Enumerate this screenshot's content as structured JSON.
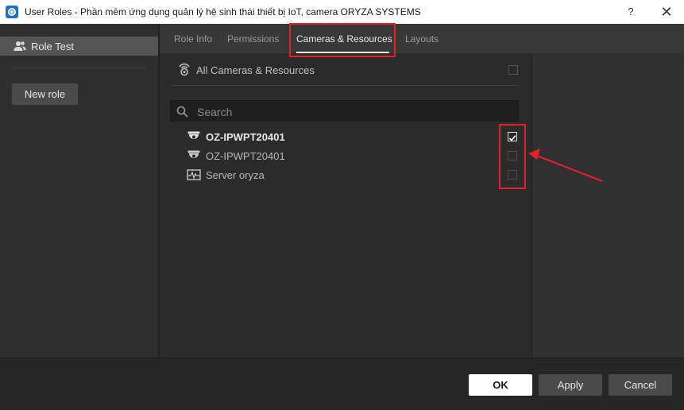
{
  "window": {
    "title": "User Roles - Phần mềm ứng dụng quản lý hệ sinh thái thiết bị IoT, camera ORYZA SYSTEMS",
    "help_label": "?",
    "close_label": "✕",
    "app_icon": "oryza-logo-icon"
  },
  "sidebar": {
    "roles": [
      {
        "label": "Role Test",
        "icon": "user-group-icon",
        "selected": true
      }
    ],
    "new_role_label": "New role"
  },
  "tabs": [
    {
      "label": "Role Info",
      "active": false
    },
    {
      "label": "Permissions",
      "active": false
    },
    {
      "label": "Cameras & Resources",
      "active": true
    },
    {
      "label": "Layouts",
      "active": false
    }
  ],
  "resources": {
    "all_label": "All Cameras & Resources",
    "all_checked": false,
    "search_placeholder": "Search",
    "items": [
      {
        "label": "OZ-IPWPT20401",
        "icon": "dome-camera-icon",
        "checked": true
      },
      {
        "label": "OZ-IPWPT20401",
        "icon": "dome-camera-icon",
        "checked": false
      },
      {
        "label": "Server oryza",
        "icon": "server-pulse-icon",
        "checked": false
      }
    ]
  },
  "footer": {
    "ok_label": "OK",
    "apply_label": "Apply",
    "cancel_label": "Cancel"
  },
  "colors": {
    "annotation_red": "#e0212a",
    "background": "#2b2b2b",
    "ok_button": "#ffffff"
  }
}
